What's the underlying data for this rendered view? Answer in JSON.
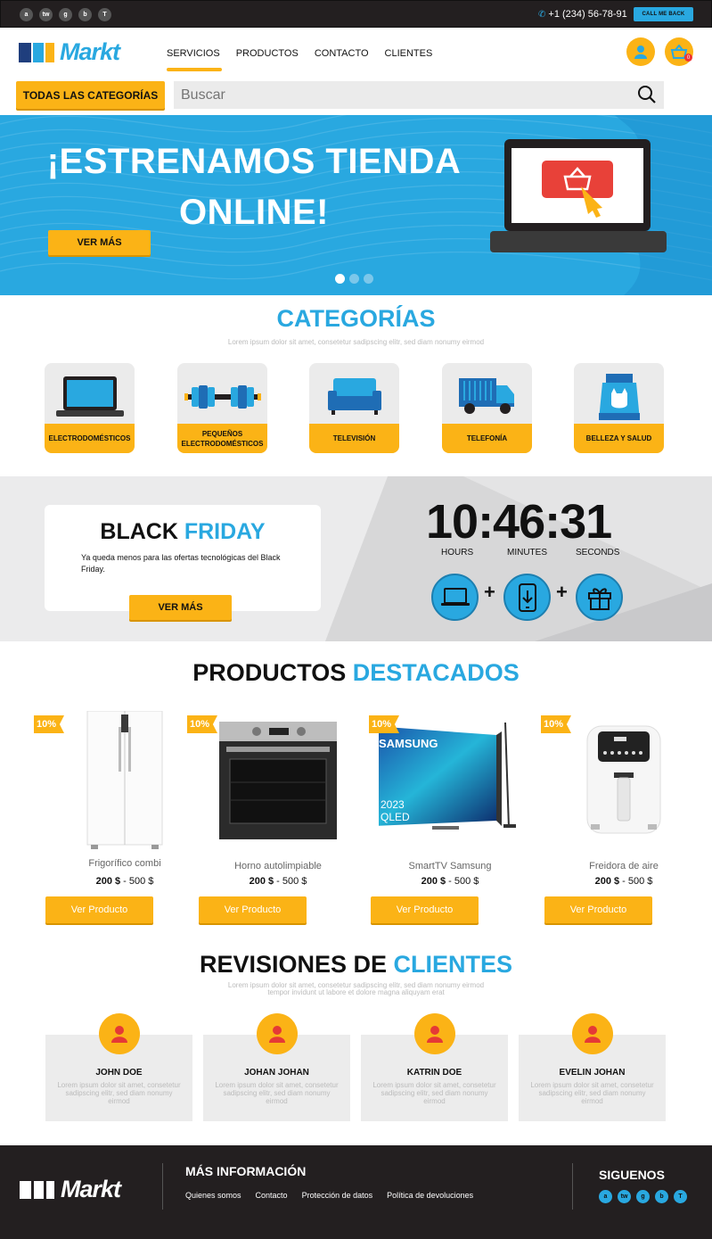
{
  "topbar": {
    "socials": [
      "a",
      "tw",
      "g",
      "b",
      "T"
    ],
    "phone": "+1 (234) 56-78-91",
    "call_me_back": "CALL ME BACK"
  },
  "header": {
    "logo_text": "Markt",
    "nav": [
      "SERVICIOS",
      "PRODUCTOS",
      "CONTACTO",
      "CLIENTES"
    ],
    "active_nav": "SERVICIOS",
    "cart_count": "0"
  },
  "search": {
    "categories_label": "TODAS LAS CATEGORÍAS",
    "placeholder": "Buscar"
  },
  "hero": {
    "title": "¡ESTRENAMOS TIENDA ONLINE!",
    "button": "VER MÁS",
    "slides": 3,
    "active_slide": 1
  },
  "categories": {
    "title": "CATEGORÍAS",
    "subtitle": "Lorem ipsum dolor sit amet, consetetur sadipscing elitr, sed diam nonumy eirmod",
    "items": [
      {
        "label": "ELECTRODOMÉSTICOS",
        "icon": "laptop-icon"
      },
      {
        "label": "PEQUEÑOS ELECTRODOMÉSTICOS",
        "icon": "dumbbell-icon"
      },
      {
        "label": "TELEVISIÓN",
        "icon": "sofa-icon"
      },
      {
        "label": "TELEFONÍA",
        "icon": "truck-icon"
      },
      {
        "label": "BELLEZA Y SALUD",
        "icon": "pet-food-icon"
      }
    ]
  },
  "black_friday": {
    "title_a": "BLACK",
    "title_b": "FRIDAY",
    "text": "Ya queda menos para las ofertas tecnológicas del Black Friday.",
    "button": "VER MÁS",
    "timer": "10:46:31",
    "labels": [
      "HOURS",
      "MINUTES",
      "SECONDS"
    ],
    "icons": [
      "laptop-icon",
      "phone-download-icon",
      "gift-icon"
    ]
  },
  "featured": {
    "title_a": "PRODUCTOS",
    "title_b": "DESTACADOS",
    "products": [
      {
        "name": "Frigorífico combi",
        "price_from": "200 $",
        "price_to": "500 $",
        "discount": "10%",
        "button": "Ver Producto"
      },
      {
        "name": "Horno autolimpiable",
        "price_from": "200 $",
        "price_to": "500 $",
        "discount": "10%",
        "button": "Ver Producto"
      },
      {
        "name": "SmartTV Samsung",
        "price_from": "200 $",
        "price_to": "500 $",
        "discount": "10%",
        "button": "Ver Producto"
      },
      {
        "name": "Freidora de aire",
        "price_from": "200 $",
        "price_to": "500 $",
        "discount": "10%",
        "button": "Ver Producto"
      }
    ],
    "tv_brand": "SAMSUNG",
    "tv_model": "2023 QLED"
  },
  "reviews": {
    "title_a": "REVISIONES DE",
    "title_b": "CLIENTES",
    "subtitle_1": "Lorem ipsum dolor sit amet, consetetur sadipscing elitr, sed diam nonumy eirmod",
    "subtitle_2": "tempor invidunt ut labore et dolore magna aliquyam erat",
    "items": [
      {
        "name": "JOHN DOE",
        "text": "Lorem ipsum dolor sit amet, consetetur sadipscing elitr, sed diam nonumy eirmod"
      },
      {
        "name": "JOHAN JOHAN",
        "text": "Lorem ipsum dolor sit amet, consetetur sadipscing elitr, sed diam nonumy eirmod"
      },
      {
        "name": "KATRIN DOE",
        "text": "Lorem ipsum dolor sit amet, consetetur sadipscing elitr, sed diam nonumy eirmod"
      },
      {
        "name": "EVELIN JOHAN",
        "text": "Lorem ipsum dolor sit amet, consetetur sadipscing elitr, sed diam nonumy eirmod"
      }
    ]
  },
  "footer": {
    "logo_text": "Markt",
    "info_title": "MÁS INFORMACIÓN",
    "links": [
      "Quienes somos",
      "Contacto",
      "Protección de datos",
      "Política de devoluciones"
    ],
    "follow_title": "SIGUENOS",
    "socials": [
      "a",
      "tw",
      "g",
      "b",
      "T"
    ]
  },
  "colors": {
    "accent_blue": "#29a8e0",
    "accent_yellow": "#fbb316",
    "dark": "#231f20"
  }
}
